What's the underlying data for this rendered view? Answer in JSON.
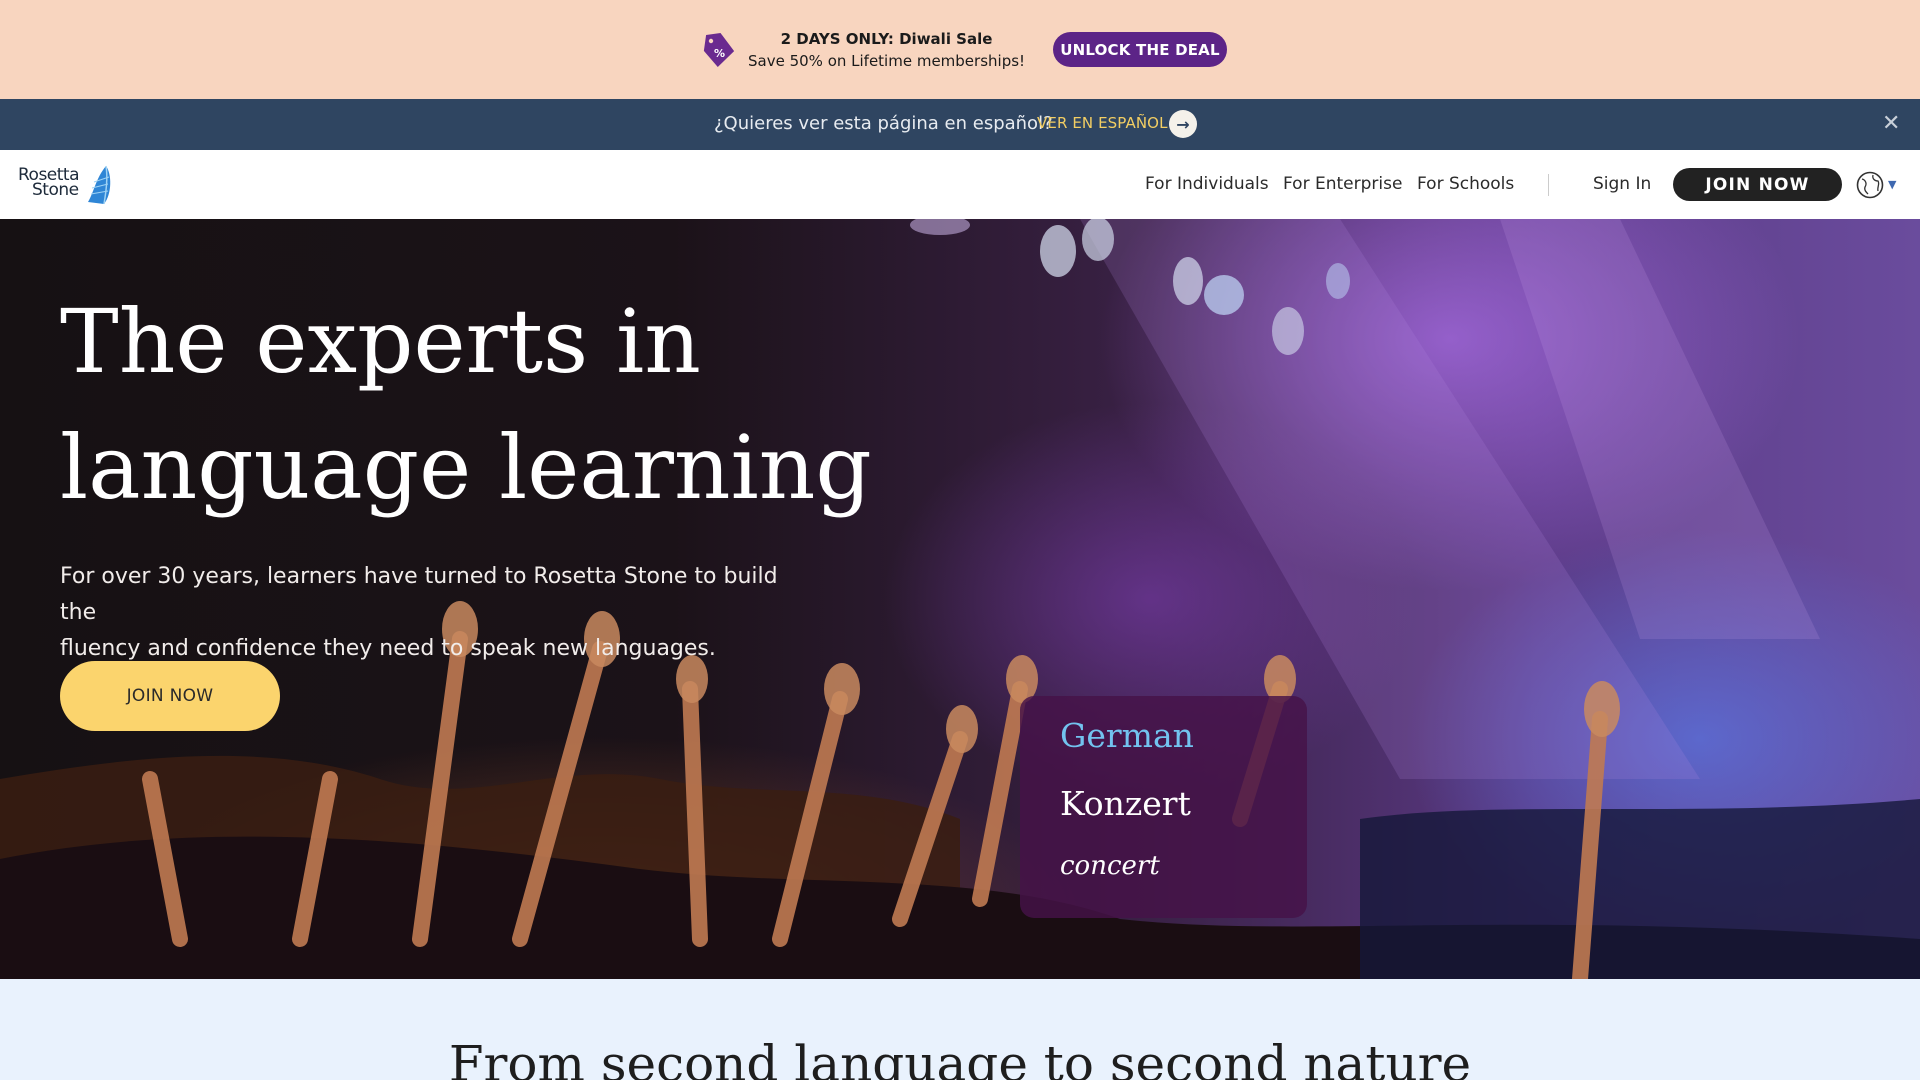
{
  "promo": {
    "title": "2 DAYS ONLY: Diwali Sale",
    "subtitle": "Save 50% on Lifetime memberships!",
    "cta": "UNLOCK THE DEAL",
    "icon": "discount-tag-icon",
    "bg_color": "#f8d5bf",
    "cta_color": "#5c2487"
  },
  "langbar": {
    "question": "¿Quieres ver esta página en español?",
    "link": "VER EN ESPAÑOL",
    "arrow_icon": "arrow-right-icon",
    "close_icon": "close-icon",
    "bg_color": "#2f4561"
  },
  "nav": {
    "logo_line1": "Rosetta",
    "logo_line2": "Stone",
    "items": [
      "For Individuals",
      "For Enterprise",
      "For Schools"
    ],
    "sign_in": "Sign In",
    "join": "JOIN NOW",
    "globe_icon": "globe-icon"
  },
  "hero": {
    "title_line1": "The experts in",
    "title_line2": "language learning",
    "subtitle_line1": "For over 30 years, learners have turned to Rosetta Stone to build the",
    "subtitle_line2": "fluency and confidence they need to speak new languages.",
    "cta": "JOIN NOW",
    "cta_color": "#fbd46d",
    "word_card": {
      "language": "German",
      "word": "Konzert",
      "translation": "concert"
    }
  },
  "section2": {
    "title": "From second language to second nature"
  }
}
